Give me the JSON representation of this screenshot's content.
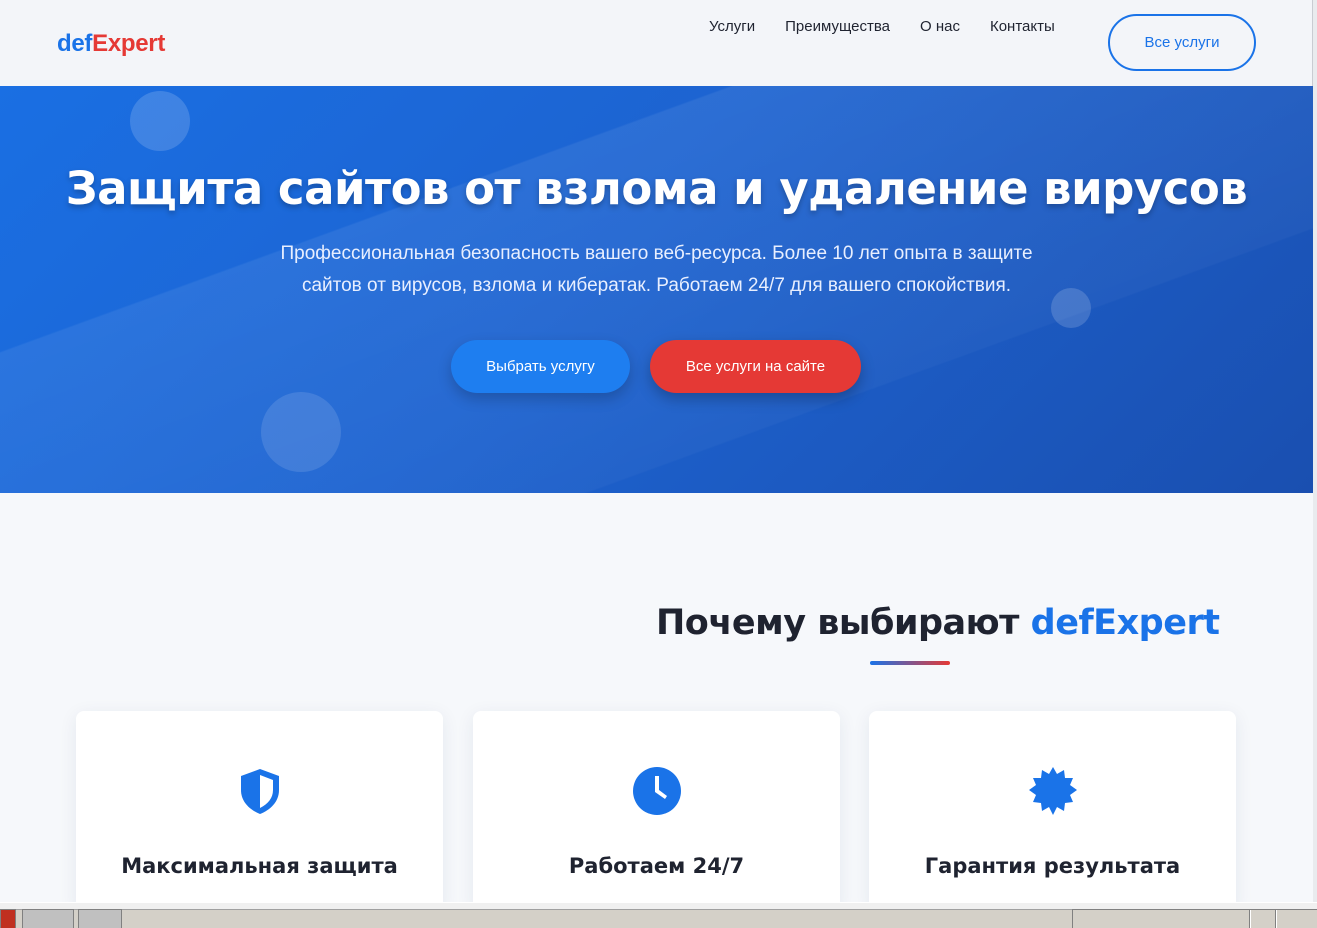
{
  "header": {
    "logo_part1": "def",
    "logo_part2": "Expert",
    "nav": [
      "Услуги",
      "Преимущества",
      "О нас",
      "Контакты"
    ],
    "cta_label": "Все услуги"
  },
  "hero": {
    "title": "Защита сайтов от взлома и удаление вирусов",
    "subtitle": "Профессиональная безопасность вашего веб-ресурса. Более 10 лет опыта в защите сайтов от вирусов, взлома и кибератак. Работаем 24/7 для вашего спокойствия.",
    "primary_button": "Выбрать услугу",
    "secondary_button": "Все услуги на сайте"
  },
  "features": {
    "title_prefix": "Почему выбирают ",
    "title_brand": "defExpert",
    "cards": [
      {
        "icon": "shield-icon",
        "title": "Максимальная защита"
      },
      {
        "icon": "clock-icon",
        "title": "Работаем 24/7"
      },
      {
        "icon": "badge-icon",
        "title": "Гарантия результата"
      }
    ]
  },
  "colors": {
    "accent": "#1a73e8",
    "danger": "#e53935",
    "hero_gradient_start": "#1a6fe3",
    "hero_gradient_end": "#1a4fb0"
  }
}
